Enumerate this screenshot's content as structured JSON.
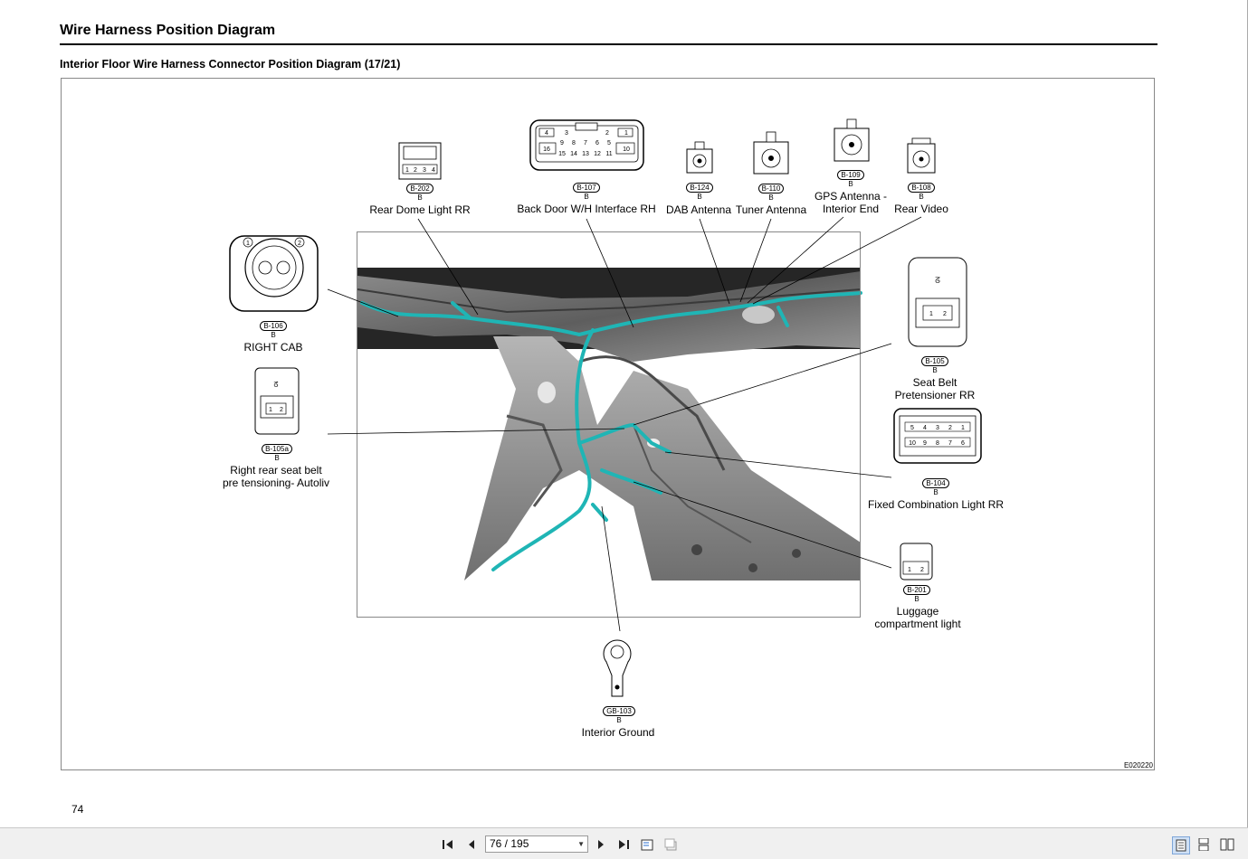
{
  "document": {
    "title": "Wire Harness Position Diagram",
    "subtitle": "Interior Floor Wire Harness Connector Position Diagram (17/21)",
    "figure_id": "E020220",
    "page_number": "74"
  },
  "connectors": [
    {
      "id": "B-202",
      "sub": "B",
      "name": "Rear Dome Light RR",
      "pins": [
        "1",
        "2",
        "3",
        "4"
      ]
    },
    {
      "id": "B-107",
      "sub": "B",
      "name": "Back Door W/H Interface RH",
      "pins": [
        "4",
        "3",
        "2",
        "1",
        "9",
        "8",
        "7",
        "6",
        "5",
        "16",
        "10",
        "15",
        "14",
        "13",
        "12",
        "11"
      ]
    },
    {
      "id": "B-124",
      "sub": "B",
      "name": "DAB Antenna"
    },
    {
      "id": "B-110",
      "sub": "B",
      "name": "Tuner Antenna"
    },
    {
      "id": "B-109",
      "sub": "B",
      "name_lines": [
        "GPS Antenna -",
        "Interior End"
      ]
    },
    {
      "id": "B-108",
      "sub": "B",
      "name": "Rear Video"
    },
    {
      "id": "B-106",
      "sub": "B",
      "name": "RIGHT CAB",
      "pins": [
        "1",
        "2"
      ]
    },
    {
      "id": "B-105a",
      "sub": "B",
      "name_lines": [
        "Right rear seat belt",
        "pre tensioning- Autoliv"
      ],
      "pins": [
        "1",
        "2"
      ]
    },
    {
      "id": "B-105",
      "sub": "B",
      "name_lines": [
        "Seat Belt",
        "Pretensioner RR"
      ],
      "pins": [
        "1",
        "2"
      ]
    },
    {
      "id": "B-104",
      "sub": "B",
      "name": "Fixed Combination Light RR",
      "pins": [
        "5",
        "4",
        "3",
        "2",
        "1",
        "10",
        "9",
        "8",
        "7",
        "6"
      ]
    },
    {
      "id": "B-201",
      "sub": "B",
      "name_lines": [
        "Luggage",
        "compartment light"
      ],
      "pins": [
        "1",
        "2"
      ]
    },
    {
      "id": "GB-103",
      "sub": "B",
      "name": "Interior Ground"
    }
  ],
  "viewer": {
    "page_field": "76 / 195",
    "icons": [
      "first-page-icon",
      "previous-page-icon",
      "next-page-icon",
      "last-page-icon",
      "fit-page-icon",
      "fit-width-icon",
      "single-page-icon",
      "continuous-page-icon",
      "two-page-icon"
    ]
  },
  "colors": {
    "harness": "#1fb5b5",
    "body_panel": "#6b6b6b",
    "background_dark": "#2a2a2a"
  }
}
